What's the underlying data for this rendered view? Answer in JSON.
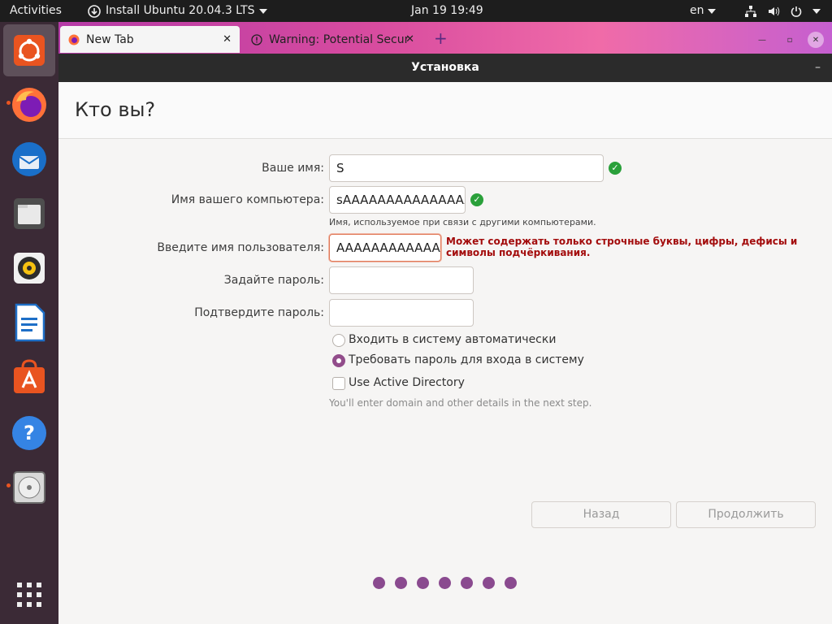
{
  "topbar": {
    "activities": "Activities",
    "app_menu": "Install Ubuntu 20.04.3 LTS",
    "clock": "Jan 19  19:49",
    "lang": "en"
  },
  "browser": {
    "tabs": [
      {
        "label": "New Tab",
        "icon": "firefox-icon"
      },
      {
        "label": "Warning: Potential Secur",
        "icon": "warning-icon"
      }
    ]
  },
  "installer": {
    "window_title": "Установка",
    "page_title": "Кто вы?",
    "fields": {
      "your_name_label": "Ваше имя:",
      "your_name_value": "S",
      "computer_name_label": "Имя вашего компьютера:",
      "computer_name_value": "sAAAAAAAAAAAAAAA",
      "computer_name_hint": "Имя, используемое при связи с другими компьютерами.",
      "username_label": "Введите имя пользователя:",
      "username_value": "AAAAAAAAAAAA|",
      "username_error": "Может содержать только строчные буквы, цифры, дефисы и символы подчёркивания.",
      "password_label": "Задайте пароль:",
      "password_value": "",
      "confirm_label": "Подтвердите пароль:",
      "confirm_value": ""
    },
    "options": {
      "auto_login": "Входить в систему автоматически",
      "require_password": "Требовать пароль для входа в систему",
      "selected": "require_password",
      "active_directory": "Use Active Directory",
      "active_directory_checked": false,
      "ad_hint": "You'll enter domain and other details in the next step."
    },
    "buttons": {
      "back": "Назад",
      "continue": "Продолжить"
    },
    "progress_steps": 7
  },
  "colors": {
    "accent": "#924d8b",
    "ok": "#2aa03a",
    "error": "#a30c0c",
    "ubuntu_orange": "#e95420"
  }
}
